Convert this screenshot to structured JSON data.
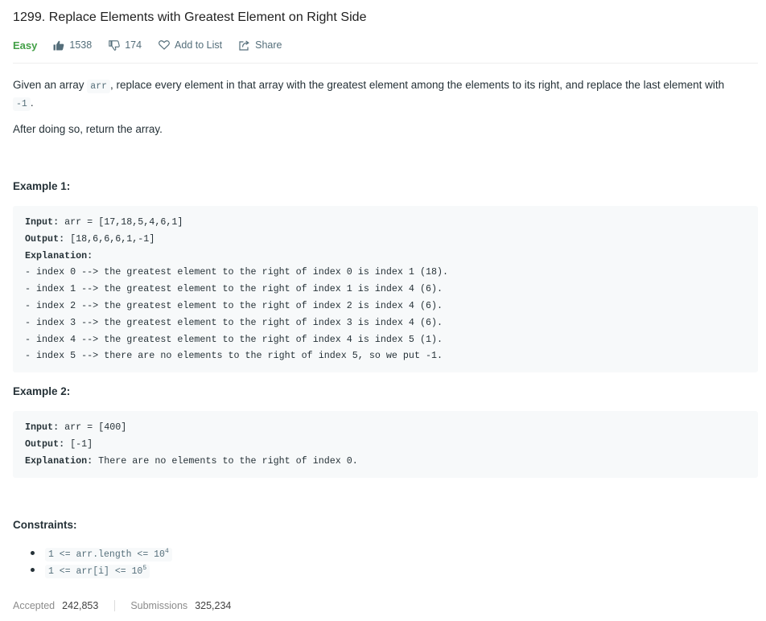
{
  "problem": {
    "title": "1299. Replace Elements with Greatest Element on Right Side",
    "difficulty": "Easy",
    "likes": "1538",
    "dislikes": "174",
    "add_to_list": "Add to List",
    "share": "Share"
  },
  "description": {
    "p1_a": "Given an array ",
    "p1_code": "arr",
    "p1_b": ", replace every element in that array with the greatest element among the elements to its right, and replace the last element with ",
    "p1_code2": "-1",
    "p1_c": ".",
    "p2": "After doing so, return the array."
  },
  "examples": [
    {
      "heading": "Example 1:",
      "input_label": "Input:",
      "input": " arr = [17,18,5,4,6,1]",
      "output_label": "Output:",
      "output": " [18,6,6,6,1,-1]",
      "explanation_label": "Explanation:",
      "explanation_lines": [
        "- index 0 --> the greatest element to the right of index 0 is index 1 (18).",
        "- index 1 --> the greatest element to the right of index 1 is index 4 (6).",
        "- index 2 --> the greatest element to the right of index 2 is index 4 (6).",
        "- index 3 --> the greatest element to the right of index 3 is index 4 (6).",
        "- index 4 --> the greatest element to the right of index 4 is index 5 (1).",
        "- index 5 --> there are no elements to the right of index 5, so we put -1."
      ]
    },
    {
      "heading": "Example 2:",
      "input_label": "Input:",
      "input": " arr = [400]",
      "output_label": "Output:",
      "output": " [-1]",
      "explanation_label": "Explanation:",
      "explanation_inline": " There are no elements to the right of index 0."
    }
  ],
  "constraints": {
    "heading": "Constraints:",
    "items": [
      {
        "code": "1 <= arr.length <= 10",
        "sup": "4"
      },
      {
        "code": "1 <= arr[i] <= 10",
        "sup": "5"
      }
    ]
  },
  "stats": {
    "accepted_label": "Accepted",
    "accepted_value": "242,853",
    "submissions_label": "Submissions",
    "submissions_value": "325,234"
  },
  "colors": {
    "easy": "#43a047",
    "code_bg": "#f7f9fa",
    "text": "#263238",
    "muted": "#546e7a"
  },
  "icons": [
    "thumbs-up-icon",
    "thumbs-down-icon",
    "heart-icon",
    "share-icon"
  ]
}
